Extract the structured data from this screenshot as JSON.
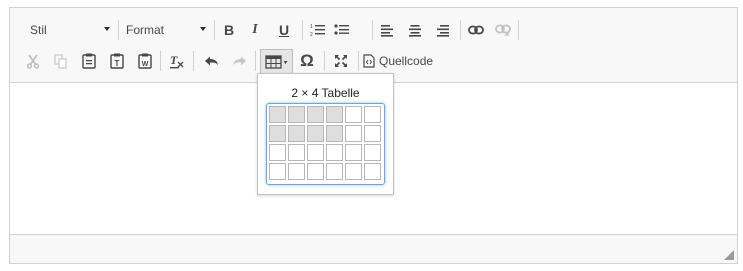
{
  "toolbar": {
    "style_combo": {
      "label": "Stil"
    },
    "format_combo": {
      "label": "Format"
    },
    "row1": [
      {
        "name": "bold-icon",
        "glyph": "B"
      },
      {
        "name": "italic-icon",
        "glyph": "I"
      },
      {
        "name": "underline-icon",
        "glyph": "U"
      },
      {
        "name": "numbered-list-icon"
      },
      {
        "name": "bulleted-list-icon"
      },
      {
        "name": "align-left-icon"
      },
      {
        "name": "align-center-icon"
      },
      {
        "name": "align-right-icon"
      },
      {
        "name": "link-icon"
      },
      {
        "name": "unlink-icon"
      }
    ],
    "row2": [
      {
        "name": "cut-icon"
      },
      {
        "name": "copy-icon"
      },
      {
        "name": "paste-icon"
      },
      {
        "name": "paste-text-icon"
      },
      {
        "name": "paste-word-icon"
      },
      {
        "name": "remove-format-icon"
      },
      {
        "name": "undo-icon"
      },
      {
        "name": "redo-icon"
      },
      {
        "name": "table-icon"
      },
      {
        "name": "special-char-icon",
        "glyph": "Ω"
      },
      {
        "name": "maximize-icon"
      },
      {
        "name": "source-icon"
      }
    ],
    "source_label": "Quellcode"
  },
  "table_picker": {
    "title": "2 × 4 Tabelle",
    "rows": 4,
    "cols": 6,
    "selected_rows": 2,
    "selected_cols": 4
  },
  "colors": {
    "toolbar_bg": "#f8f8f8",
    "border": "#d1d1d1",
    "grid_focus": "#6aa6ea",
    "cell_selected": "#dedede"
  }
}
